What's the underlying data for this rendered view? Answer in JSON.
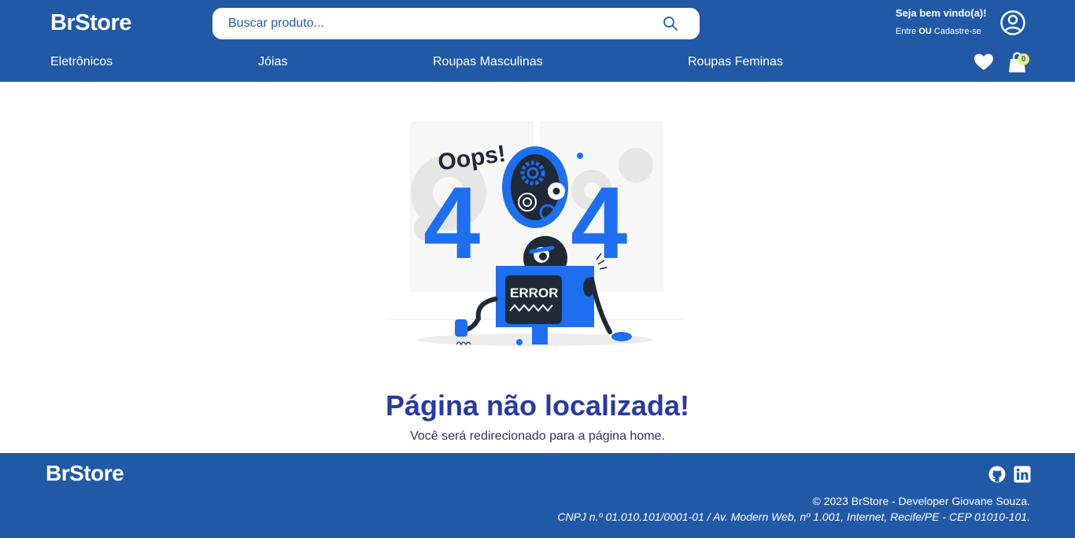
{
  "header": {
    "logo": "BrStore",
    "search_placeholder": "Buscar produto...",
    "welcome": "Seja bem vindo(a)!",
    "login": "Entre",
    "separator": "OU",
    "signup": "Cadastre-se",
    "nav": [
      "Eletrônicos",
      "Jóias",
      "Roupas Masculinas",
      "Roupas Feminas"
    ],
    "cart_count": "0"
  },
  "main": {
    "illustration": {
      "oops": "Oops!",
      "digit_left": "4",
      "digit_right": "4",
      "error": "ERROR"
    },
    "title": "Página não localizada!",
    "subtitle": "Você será redirecionado para a página home."
  },
  "footer": {
    "logo": "BrStore",
    "copyright": "© 2023 BrStore - Developer Giovane Souza.",
    "address": "CNPJ n.º 01.010.101/0001-01 / Av. Modern Web, nº 1.001, Internet, Recife/PE - CEP 01010-101."
  },
  "colors": {
    "brand": "#2259a7",
    "accent_blue": "#1d6ff0",
    "title": "#2a3a9e",
    "badge": "#e8f37a"
  },
  "icons": [
    "search-icon",
    "user-circle-icon",
    "heart-icon",
    "shopping-bag-icon",
    "github-icon",
    "linkedin-icon"
  ]
}
